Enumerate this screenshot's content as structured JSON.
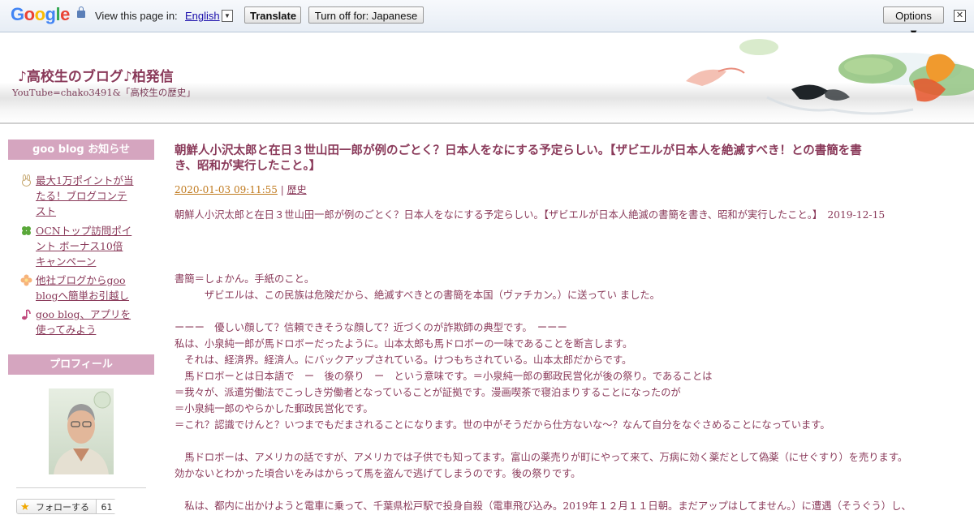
{
  "translate_bar": {
    "logo_text": "Google",
    "prompt": "View this page in:",
    "language": "English",
    "dropdown_glyph": "▼",
    "translate_label": "Translate",
    "turn_off_label": "Turn off for: Japanese",
    "options_label": "Options ▼",
    "close_glyph": "✕"
  },
  "header": {
    "title": "♪高校生のブログ♪柏発信",
    "description": "YouTube=chako3491&「高校生の歴史」"
  },
  "sidebar": {
    "notice_heading": "goo blog お知らせ",
    "notices": [
      {
        "icon": "rabbit-icon",
        "lines": [
          "最大1万ポイントが当",
          "たる！ブログコンテ",
          "スト"
        ]
      },
      {
        "icon": "clover-icon",
        "lines": [
          "OCNトップ訪問ポイ",
          "ント ボーナス10倍",
          "キャンペーン"
        ]
      },
      {
        "icon": "flower-icon",
        "lines": [
          "他社ブログからgoo",
          "blogへ簡単お引越し"
        ]
      },
      {
        "icon": "music-note-icon",
        "lines": [
          "goo blog、アプリを",
          "使ってみよう"
        ]
      }
    ],
    "profile_heading": "プロフィール",
    "follow_label": "フォローする",
    "follow_count": "61"
  },
  "post": {
    "title_line1": "朝鮮人小沢太郎と在日３世山田一郎が例のごとく？日本人をなにする予定らしい。【ザビエルが日本人を絶滅すべき！との書簡を書",
    "title_line2": "き、昭和が実行したこと。】",
    "date": "2020-01-03 09:11:55",
    "meta_sep": " | ",
    "category": "歴史",
    "lines": [
      "朝鮮人小沢太郎と在日３世山田一郎が例のごとく？日本人をなにする予定らしい。【ザビエルが日本人絶滅の書簡を書き、昭和が実行したこと。】　2019-12-15",
      "書簡＝しょかん。手紙のこと。",
      "　　　ザビエルは、この民族は危険だから、絶滅すべきとの書簡を本国（ヴァチカン。）に送ってい ました。",
      "ーーー　優しい顔して？信頼できそうな顔して？近づくのが詐欺師の典型です。　ーーー",
      "私は、小泉純一郎が馬ドロボーだったように。山本太郎も馬ドロボーの一味であることを断言します。",
      "　それは、経済界。経済人。にバックアップされている。けつもちされている。山本太郎だからです。",
      "　馬ドロボーとは日本語で　ー　後の祭り　ー　という意味です。＝小泉純一郎の郵政民営化が後の祭り。であることは",
      "＝我々が、派遣労働法でこっしき労働者となっていることが証拠です。漫画喫茶で寝泊まりすることになったのが",
      "＝小泉純一郎のやらかした郵政民営化です。",
      "＝これ？認識でけんと？いつまでもだまされることになります。世の中がそうだから仕方ないな〜？なんて自分をなぐさめることになっています。",
      "　馬ドロボーは、アメリカの話ですが、アメリカでは子供でも知ってます。富山の薬売りが町にやって来て、万病に効く薬だとして偽薬（にせぐすり）を売ります。",
      "効かないとわかった頃合いをみはからって馬を盗んで逃げてしまうのです。後の祭りです。",
      "　私は、都内に出かけようと電車に乗って、千葉県松戸駅で投身自殺（電車飛び込み。2019年１２月１１日朝。まだアップはしてません。）に遭遇（そうぐう）し、"
    ]
  },
  "colors": {
    "accent": "#8a3a5a",
    "sidebar_heading_bg": "#d5a5bf",
    "date_link": "#c07a1e"
  }
}
